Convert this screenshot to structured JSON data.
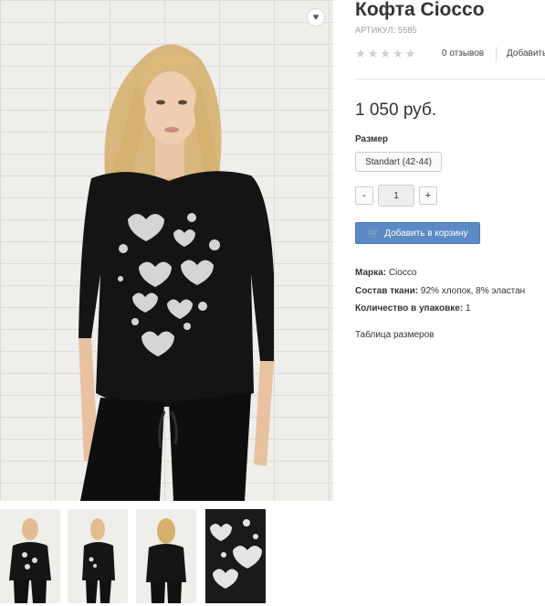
{
  "product": {
    "title": "Кофта Ciocco",
    "sku": "АРТИКУЛ: 5585",
    "stars": "★★★★★",
    "reviews": "0 отзывов",
    "add_review": "Добавить",
    "price": "1 050 руб."
  },
  "options": {
    "size_label": "Размер",
    "size_value": "Standart (42-44)"
  },
  "quantity": {
    "minus": "-",
    "value": "1",
    "plus": "+"
  },
  "cart": {
    "label": "Добавить в корзину"
  },
  "properties": [
    {
      "label": "Марка:",
      "value": "Ciocco"
    },
    {
      "label": "Состав ткани:",
      "value": "92% хлопок, 8% эластан"
    },
    {
      "label": "Количество в упаковке:",
      "value": "1"
    }
  ],
  "size_table_link": "Таблица размеров",
  "wishlist_icon": "heart-icon"
}
